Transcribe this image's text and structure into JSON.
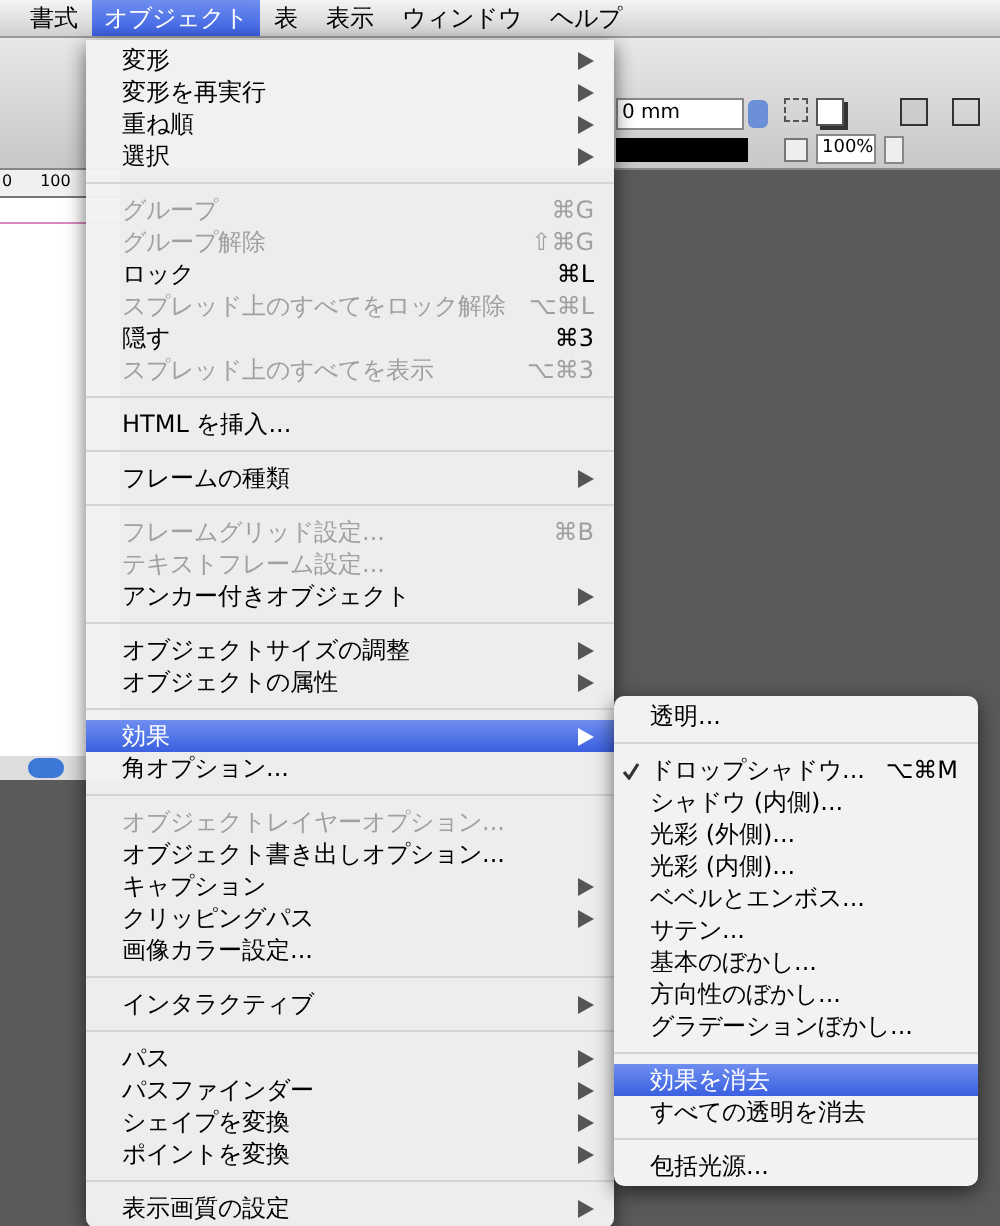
{
  "menu_bar": [
    {
      "label": "書式",
      "selected": false
    },
    {
      "label": "オブジェクト",
      "selected": true
    },
    {
      "label": "表",
      "selected": false
    },
    {
      "label": "表示",
      "selected": false
    },
    {
      "label": "ウィンドウ",
      "selected": false
    },
    {
      "label": "ヘルプ",
      "selected": false
    }
  ],
  "toolbar": {
    "stroke_weight": "0 mm",
    "opacity": "100%"
  },
  "ruler": {
    "labels": [
      "0",
      "100"
    ]
  },
  "menu": {
    "items": [
      {
        "kind": "item",
        "label": "変形",
        "has_submenu": true,
        "disabled": false,
        "selected": false
      },
      {
        "kind": "item",
        "label": "変形を再実行",
        "has_submenu": true,
        "disabled": false,
        "selected": false
      },
      {
        "kind": "item",
        "label": "重ね順",
        "has_submenu": true,
        "disabled": false,
        "selected": false
      },
      {
        "kind": "item",
        "label": "選択",
        "has_submenu": true,
        "disabled": false,
        "selected": false
      },
      {
        "kind": "separator"
      },
      {
        "kind": "item",
        "label": "グループ",
        "shortcut": "⌘G",
        "has_submenu": false,
        "disabled": true,
        "selected": false
      },
      {
        "kind": "item",
        "label": "グループ解除",
        "shortcut": "⇧⌘G",
        "has_submenu": false,
        "disabled": true,
        "selected": false
      },
      {
        "kind": "item",
        "label": "ロック",
        "shortcut": "⌘L",
        "has_submenu": false,
        "disabled": false,
        "selected": false
      },
      {
        "kind": "item",
        "label": "スプレッド上のすべてをロック解除",
        "shortcut": "⌥⌘L",
        "has_submenu": false,
        "disabled": true,
        "selected": false
      },
      {
        "kind": "item",
        "label": "隠す",
        "shortcut": "⌘3",
        "has_submenu": false,
        "disabled": false,
        "selected": false
      },
      {
        "kind": "item",
        "label": "スプレッド上のすべてを表示",
        "shortcut": "⌥⌘3",
        "has_submenu": false,
        "disabled": true,
        "selected": false
      },
      {
        "kind": "separator"
      },
      {
        "kind": "item",
        "label": "HTML を挿入...",
        "has_submenu": false,
        "disabled": false,
        "selected": false
      },
      {
        "kind": "separator"
      },
      {
        "kind": "item",
        "label": "フレームの種類",
        "has_submenu": true,
        "disabled": false,
        "selected": false
      },
      {
        "kind": "separator"
      },
      {
        "kind": "item",
        "label": "フレームグリッド設定...",
        "shortcut": "⌘B",
        "has_submenu": false,
        "disabled": true,
        "selected": false
      },
      {
        "kind": "item",
        "label": "テキストフレーム設定...",
        "has_submenu": false,
        "disabled": true,
        "selected": false
      },
      {
        "kind": "item",
        "label": "アンカー付きオブジェクト",
        "has_submenu": true,
        "disabled": false,
        "selected": false
      },
      {
        "kind": "separator"
      },
      {
        "kind": "item",
        "label": "オブジェクトサイズの調整",
        "has_submenu": true,
        "disabled": false,
        "selected": false
      },
      {
        "kind": "item",
        "label": "オブジェクトの属性",
        "has_submenu": true,
        "disabled": false,
        "selected": false
      },
      {
        "kind": "separator"
      },
      {
        "kind": "item",
        "label": "効果",
        "has_submenu": true,
        "disabled": false,
        "selected": true
      },
      {
        "kind": "item",
        "label": "角オプション...",
        "has_submenu": false,
        "disabled": false,
        "selected": false
      },
      {
        "kind": "separator"
      },
      {
        "kind": "item",
        "label": "オブジェクトレイヤーオプション...",
        "has_submenu": false,
        "disabled": true,
        "selected": false
      },
      {
        "kind": "item",
        "label": "オブジェクト書き出しオプション...",
        "has_submenu": false,
        "disabled": false,
        "selected": false
      },
      {
        "kind": "item",
        "label": "キャプション",
        "has_submenu": true,
        "disabled": false,
        "selected": false
      },
      {
        "kind": "item",
        "label": "クリッピングパス",
        "has_submenu": true,
        "disabled": false,
        "selected": false
      },
      {
        "kind": "item",
        "label": "画像カラー設定...",
        "has_submenu": false,
        "disabled": false,
        "selected": false
      },
      {
        "kind": "separator"
      },
      {
        "kind": "item",
        "label": "インタラクティブ",
        "has_submenu": true,
        "disabled": false,
        "selected": false
      },
      {
        "kind": "separator"
      },
      {
        "kind": "item",
        "label": "パス",
        "has_submenu": true,
        "disabled": false,
        "selected": false
      },
      {
        "kind": "item",
        "label": "パスファインダー",
        "has_submenu": true,
        "disabled": false,
        "selected": false
      },
      {
        "kind": "item",
        "label": "シェイプを変換",
        "has_submenu": true,
        "disabled": false,
        "selected": false
      },
      {
        "kind": "item",
        "label": "ポイントを変換",
        "has_submenu": true,
        "disabled": false,
        "selected": false
      },
      {
        "kind": "separator"
      },
      {
        "kind": "item",
        "label": "表示画質の設定",
        "has_submenu": true,
        "disabled": false,
        "selected": false
      }
    ]
  },
  "submenu": {
    "items": [
      {
        "kind": "item",
        "label": "透明...",
        "checked": false,
        "selected": false
      },
      {
        "kind": "separator"
      },
      {
        "kind": "item",
        "label": "ドロップシャドウ...",
        "shortcut": "⌥⌘M",
        "checked": true,
        "selected": false
      },
      {
        "kind": "item",
        "label": "シャドウ (内側)...",
        "checked": false,
        "selected": false
      },
      {
        "kind": "item",
        "label": "光彩 (外側)...",
        "checked": false,
        "selected": false
      },
      {
        "kind": "item",
        "label": "光彩 (内側)...",
        "checked": false,
        "selected": false
      },
      {
        "kind": "item",
        "label": "ベベルとエンボス...",
        "checked": false,
        "selected": false
      },
      {
        "kind": "item",
        "label": "サテン...",
        "checked": false,
        "selected": false
      },
      {
        "kind": "item",
        "label": "基本のぼかし...",
        "checked": false,
        "selected": false
      },
      {
        "kind": "item",
        "label": "方向性のぼかし...",
        "checked": false,
        "selected": false
      },
      {
        "kind": "item",
        "label": "グラデーションぼかし...",
        "checked": false,
        "selected": false
      },
      {
        "kind": "separator"
      },
      {
        "kind": "item",
        "label": "効果を消去",
        "checked": false,
        "selected": true
      },
      {
        "kind": "item",
        "label": "すべての透明を消去",
        "checked": false,
        "selected": false
      },
      {
        "kind": "separator"
      },
      {
        "kind": "item",
        "label": "包括光源...",
        "checked": false,
        "selected": false
      }
    ]
  }
}
